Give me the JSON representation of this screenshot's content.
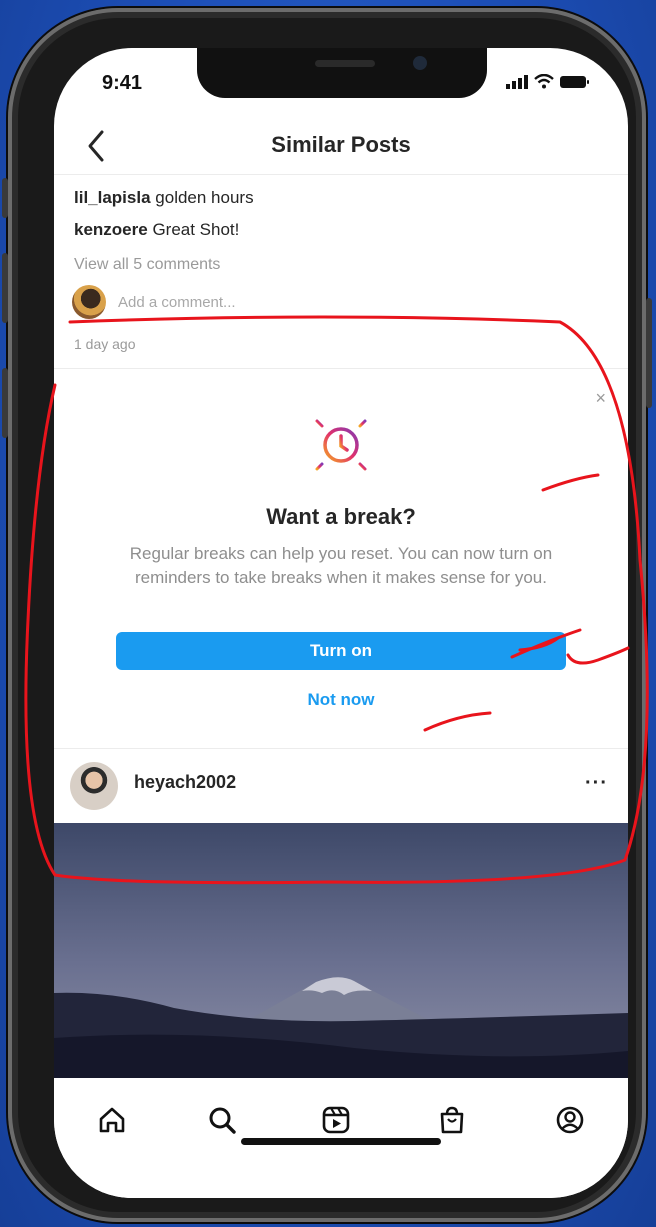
{
  "status_bar": {
    "time": "9:41"
  },
  "header": {
    "title": "Similar Posts"
  },
  "comments": [
    {
      "user": "lil_lapisla",
      "text": "golden hours"
    },
    {
      "user": "kenzoere",
      "text": "Great Shot!"
    }
  ],
  "view_all_comments": "View all 5 comments",
  "add_comment_placeholder": "Add a comment...",
  "time_ago": "1 day ago",
  "break_card": {
    "close": "×",
    "title": "Want a break?",
    "body": "Regular breaks can help you reset. You can now turn on reminders to take breaks when it makes sense for you.",
    "primary_button": "Turn on",
    "secondary_button": "Not now"
  },
  "post": {
    "username": "heyach2002",
    "more": "···"
  },
  "bottom_nav": {
    "items": [
      {
        "icon": "home-icon"
      },
      {
        "icon": "search-icon"
      },
      {
        "icon": "reels-icon"
      },
      {
        "icon": "shop-icon"
      },
      {
        "icon": "profile-icon"
      }
    ]
  },
  "colors": {
    "accent": "#1a9bf0",
    "annotation": "#e8141c",
    "background": "#1d4fb8"
  }
}
